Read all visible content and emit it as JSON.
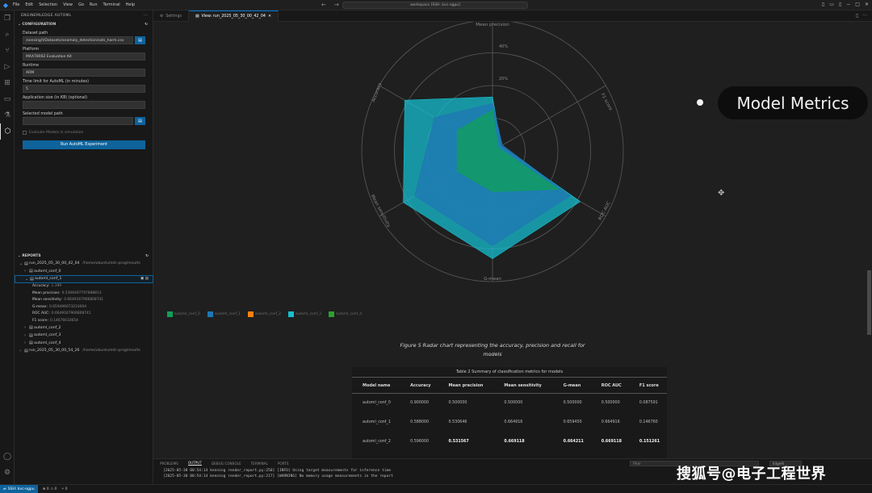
{
  "titlebar": {
    "menu": [
      "File",
      "Edit",
      "Selection",
      "View",
      "Go",
      "Run",
      "Terminal",
      "Help"
    ],
    "command_center": "workspace [SSH: kvc-ogpu]"
  },
  "sidebar": {
    "header": "ENGINEMLEDGE AUTOML",
    "config_title": "CONFIGURATION",
    "fields": {
      "dataset_label": "Dataset path",
      "dataset_value": "/sensing/VDatasets/anomaly_detection/sats_harm.csv",
      "platform_label": "Platform",
      "platform_value": "MAX78002 Evaluation Kit",
      "runtime_label": "Runtime",
      "runtime_value": "ARM",
      "time_label": "Time limit for AutoML (in minutes)",
      "time_value": "5",
      "appsize_label": "Application size (in KB) (optional)",
      "appsize_value": "",
      "model_label": "Selected model path",
      "model_value": ""
    },
    "checkbox_label": "Evaluate Models in simulation",
    "run_button": "Run AutoML Experiment",
    "reports_title": "REPORTS",
    "tree": [
      {
        "label": "run_2025_05_30_00_42_04",
        "dim": "/home/ubuntu/edc-prog/results"
      },
      {
        "label": "automl_conf_0"
      },
      {
        "label": "automl_conf_1"
      },
      {
        "label": "automl_conf_2"
      },
      {
        "label": "automl_conf_3"
      },
      {
        "label": "automl_conf_4"
      },
      {
        "label": "run_2025_05_30_00_54_26",
        "dim": "/home/ubuntu/edc-prog/results"
      }
    ],
    "metrics": [
      {
        "name": "Accuracy",
        "value": "1.199"
      },
      {
        "name": "Mean precision",
        "value": "0.5306497797888813"
      },
      {
        "name": "Mean sensitivity",
        "value": "0.6649167906808741"
      },
      {
        "name": "G-mean",
        "value": "0.659496073210004"
      },
      {
        "name": "ROC AUC",
        "value": "0.6649167906808741"
      },
      {
        "name": "F1 score",
        "value": "0.14676033654"
      }
    ]
  },
  "tabs": [
    {
      "label": "Settings",
      "active": false
    },
    {
      "label": "View: run_2025_05_30_00_42_04",
      "active": true
    }
  ],
  "chart_data": {
    "type": "radar",
    "axes": [
      "Accuracy",
      "F1 score",
      "ROC AUC",
      "G-mean",
      "Mean sensitivity",
      "Mean precision"
    ],
    "ring_labels": [
      "20%",
      "40%"
    ],
    "max": 1.0,
    "series": [
      {
        "name": "automl_conf_0",
        "color": "#10a05a",
        "values": [
          0.25,
          0.04,
          0.47,
          0.25,
          0.25,
          0.25
        ]
      },
      {
        "name": "automl_conf_1",
        "color": "#1f77b4",
        "values": [
          0.29,
          0.07,
          0.55,
          0.58,
          0.55,
          0.41
        ]
      },
      {
        "name": "automl_conf_2",
        "color": "#ff7f0e",
        "values": [
          0.0,
          0.0,
          0.0,
          0.0,
          0.0,
          0.0
        ]
      },
      {
        "name": "automl_conf_3",
        "color": "#17becf",
        "values": [
          0.33,
          0.06,
          0.62,
          0.66,
          0.63,
          0.62
        ]
      },
      {
        "name": "automl_conf_4",
        "color": "#2ca02c",
        "values": [
          0.0,
          0.0,
          0.0,
          0.0,
          0.0,
          0.0
        ]
      }
    ]
  },
  "figure_caption": "Figure 5 Radar chart representing the accuracy, precision and recall for models",
  "table": {
    "caption": "Table 2 Summary of classification metrics for models",
    "headers": [
      "Model name",
      "Accuracy",
      "Mean precision",
      "Mean sensitivity",
      "G-mean",
      "ROC AUC",
      "F1 score"
    ],
    "rows": [
      [
        "automl_conf_0",
        "0.900000",
        "0.500000",
        "0.500000",
        "0.500000",
        "0.500000",
        "0.087591"
      ],
      [
        "automl_conf_1",
        "0.588000",
        "0.530646",
        "0.664916",
        "0.659450",
        "0.664916",
        "0.146760"
      ],
      [
        "automl_conf_2",
        "0.596000",
        "0.531567",
        "0.669118",
        "0.664211",
        "0.669118",
        "0.151261"
      ]
    ]
  },
  "overlay": {
    "pill_text": "Model Metrics"
  },
  "panel": {
    "tabs": [
      "PROBLEMS",
      "OUTPUT",
      "DEBUG CONSOLE",
      "TERMINAL",
      "PORTS"
    ],
    "active_tab": "OUTPUT",
    "filter_placeholder": "Filter",
    "channel": "EdgeAI",
    "logs": [
      "[2025-05-30 00:54:14 kenning render_report.py:250] [INFO] Using target measurements for inference time",
      "[2025-05-30 00:54:14 kenning render_report.py:217] [WARNING] No memory usage measurements in the report"
    ]
  },
  "watermark": "搜狐号@电子工程世界",
  "statusbar": {
    "remote": "SSH: kvc-ogpu",
    "problems": "0 ⚠ 0",
    "ports": "0"
  }
}
